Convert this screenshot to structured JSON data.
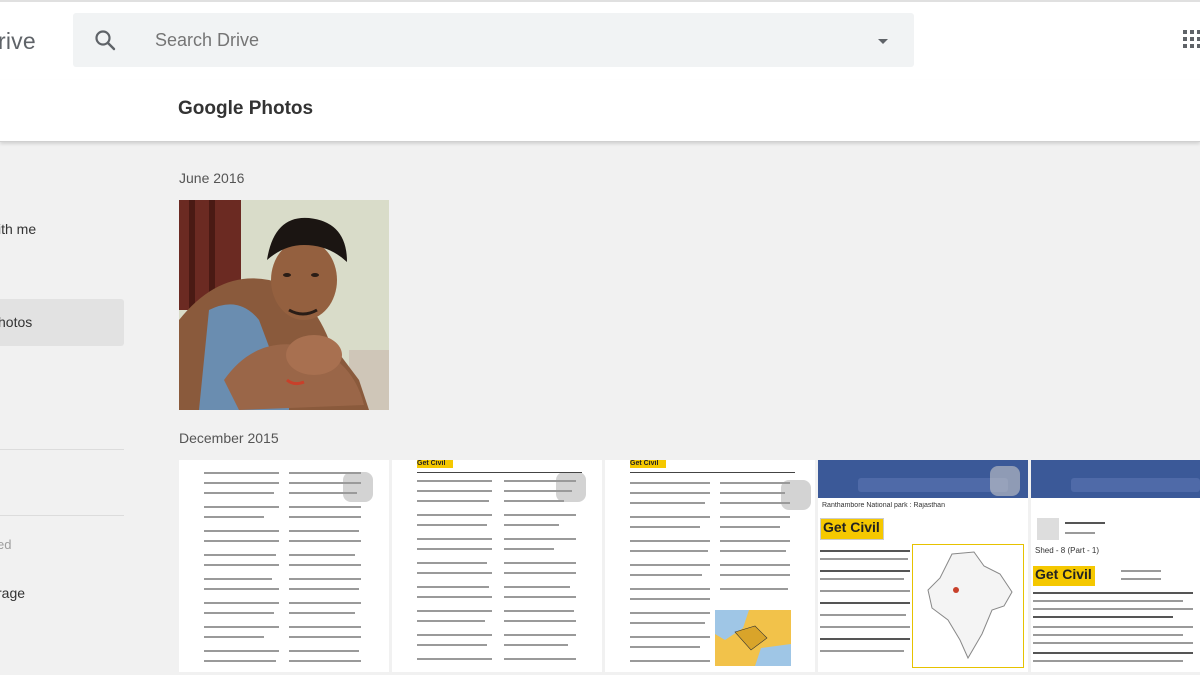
{
  "app": {
    "brand": "rive"
  },
  "search": {
    "placeholder": "Search Drive"
  },
  "header": {
    "title": "Google Photos"
  },
  "sidebar": {
    "items": [
      {
        "label": "ith me"
      },
      {
        "label": "hotos"
      },
      {
        "label": "rage"
      }
    ],
    "faded_label": "ed"
  },
  "main": {
    "sections": [
      {
        "label": "June 2016"
      },
      {
        "label": "December 2015"
      }
    ],
    "thumbs": [
      {
        "header": ""
      },
      {
        "header": "Get Civil"
      },
      {
        "header": "Get Civil"
      },
      {
        "header": "Get Civil",
        "title": "Ranthambore National park : Rajasthan"
      },
      {
        "header": "Get Civil",
        "title": "Shed - 8 (Part - 1)"
      }
    ]
  },
  "colors": {
    "facebook_blue": "#3b5998",
    "accent_yellow": "#f5c800"
  },
  "icons": [
    "search-icon",
    "chevron-down-icon",
    "apps-grid-icon"
  ]
}
